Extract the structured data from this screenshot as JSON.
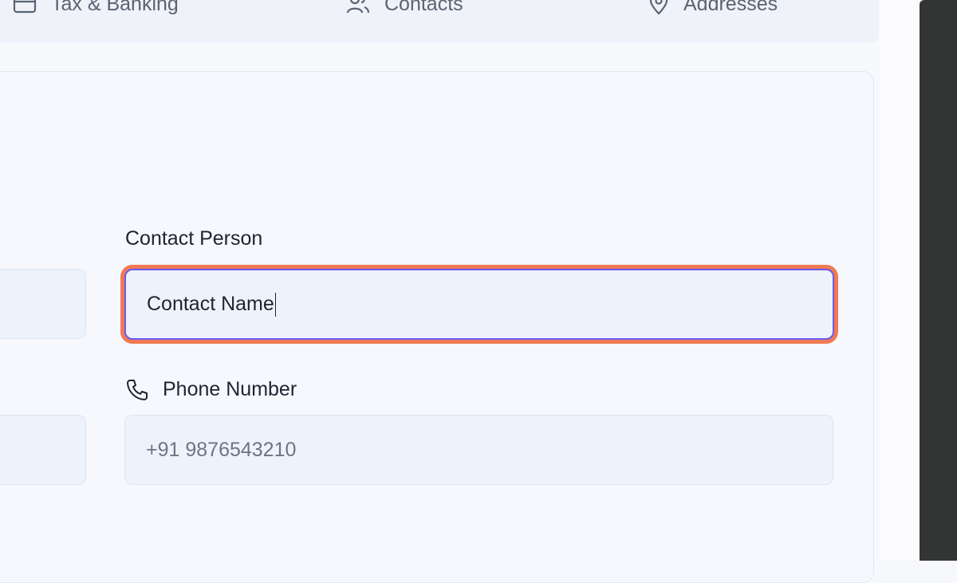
{
  "tabs": [
    {
      "label": "Tax & Banking",
      "icon": "card-icon"
    },
    {
      "label": "Contacts",
      "icon": "users-icon"
    },
    {
      "label": "Addresses",
      "icon": "map-pin-icon"
    }
  ],
  "form": {
    "contact_person": {
      "label": "Contact Person",
      "value": "Contact Name"
    },
    "phone_number": {
      "label": "Phone Number",
      "placeholder": "+91 9876543210",
      "icon": "phone-icon"
    }
  },
  "colors": {
    "focus_ring": "#f07a54",
    "focus_border": "#6a5cf0",
    "input_bg": "#eef2fb"
  }
}
